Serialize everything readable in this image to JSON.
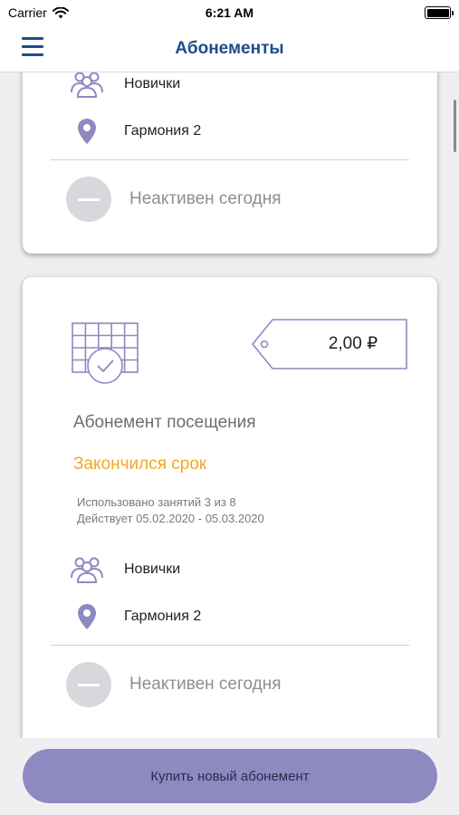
{
  "status_bar": {
    "carrier": "Carrier",
    "time": "6:21 AM",
    "icons": [
      "wifi-icon",
      "battery-icon"
    ]
  },
  "nav": {
    "title": "Абонементы",
    "menu_icon": "hamburger-menu-icon"
  },
  "colors": {
    "accent": "#1c4d8c",
    "icon_purple": "#8e89c0",
    "warning": "#f5a623",
    "button": "#8e89c0",
    "inactive_gray": "#8e8e93"
  },
  "cards": [
    {
      "group": "Новички",
      "location": "Гармония 2",
      "status": "Неактивен сегодня"
    },
    {
      "price": "2,00 ₽",
      "title": "Абонемент посещения",
      "state": "Закончился срок",
      "used": "Использовано занятий 3 из 8",
      "valid": "Действует 05.02.2020 - 05.03.2020",
      "group": "Новички",
      "location": "Гармония 2",
      "status": "Неактивен сегодня"
    }
  ],
  "buy_button": {
    "label": "Купить новый абонемент"
  }
}
